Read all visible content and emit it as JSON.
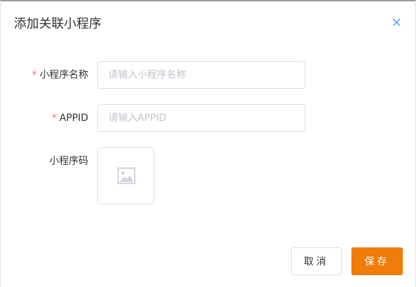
{
  "dialog": {
    "title": "添加关联小程序",
    "close_icon": "close-icon"
  },
  "form": {
    "required_mark": "*",
    "name": {
      "label": "小程序名称",
      "value": "",
      "placeholder": "请输入小程序名称",
      "required": true
    },
    "appid": {
      "label": "APPID",
      "value": "",
      "placeholder": "请输入APPID",
      "required": true
    },
    "qrcode": {
      "label": "小程序码",
      "icon": "image-placeholder-icon"
    }
  },
  "footer": {
    "cancel_label": "取消",
    "save_label": "保存"
  },
  "colors": {
    "primary": "#f07c0a",
    "required": "#f56c6c",
    "close": "#409eff",
    "border": "#dcdfe6"
  }
}
